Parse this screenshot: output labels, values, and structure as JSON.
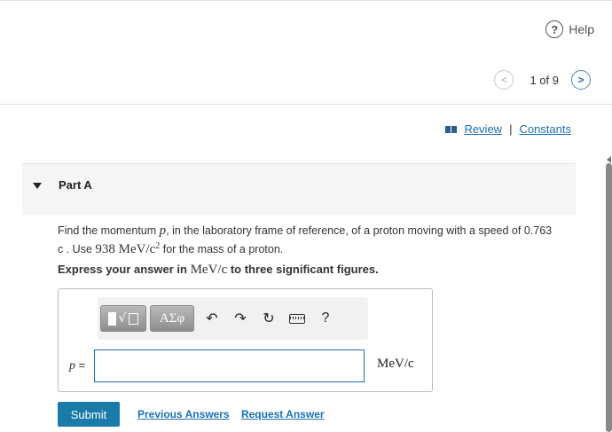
{
  "header": {
    "help_label": "Help",
    "help_icon": "?",
    "pager_text": "1 of 9",
    "prev_icon": "<",
    "next_icon": ">"
  },
  "links": {
    "review": "Review",
    "separator": "|",
    "constants": "Constants"
  },
  "part": {
    "title": "Part A"
  },
  "question": {
    "line1_a": "Find the momentum ",
    "var_p": "p",
    "line1_b": ", in the laboratory frame of reference, of a proton moving with a speed of 0.763",
    "line2_a": "c",
    "line2_b": " . Use ",
    "mass_value": "938 MeV/c",
    "mass_exp": "2",
    "line2_c": " for the mass of a proton."
  },
  "express": {
    "prefix": "Express your answer in ",
    "unit": "MeV/c",
    "suffix": " to three significant figures."
  },
  "toolbar": {
    "template_sqrt": "√",
    "greek_label": "ΑΣφ",
    "undo_icon": "↶",
    "redo_icon": "↷",
    "reset_icon": "↻",
    "help_icon": "?"
  },
  "answer": {
    "label_var": "p",
    "label_eq": " =",
    "value": "",
    "unit": "MeV/c"
  },
  "actions": {
    "submit_label": "Submit",
    "previous_answers": "Previous Answers",
    "request_answer": "Request Answer"
  }
}
